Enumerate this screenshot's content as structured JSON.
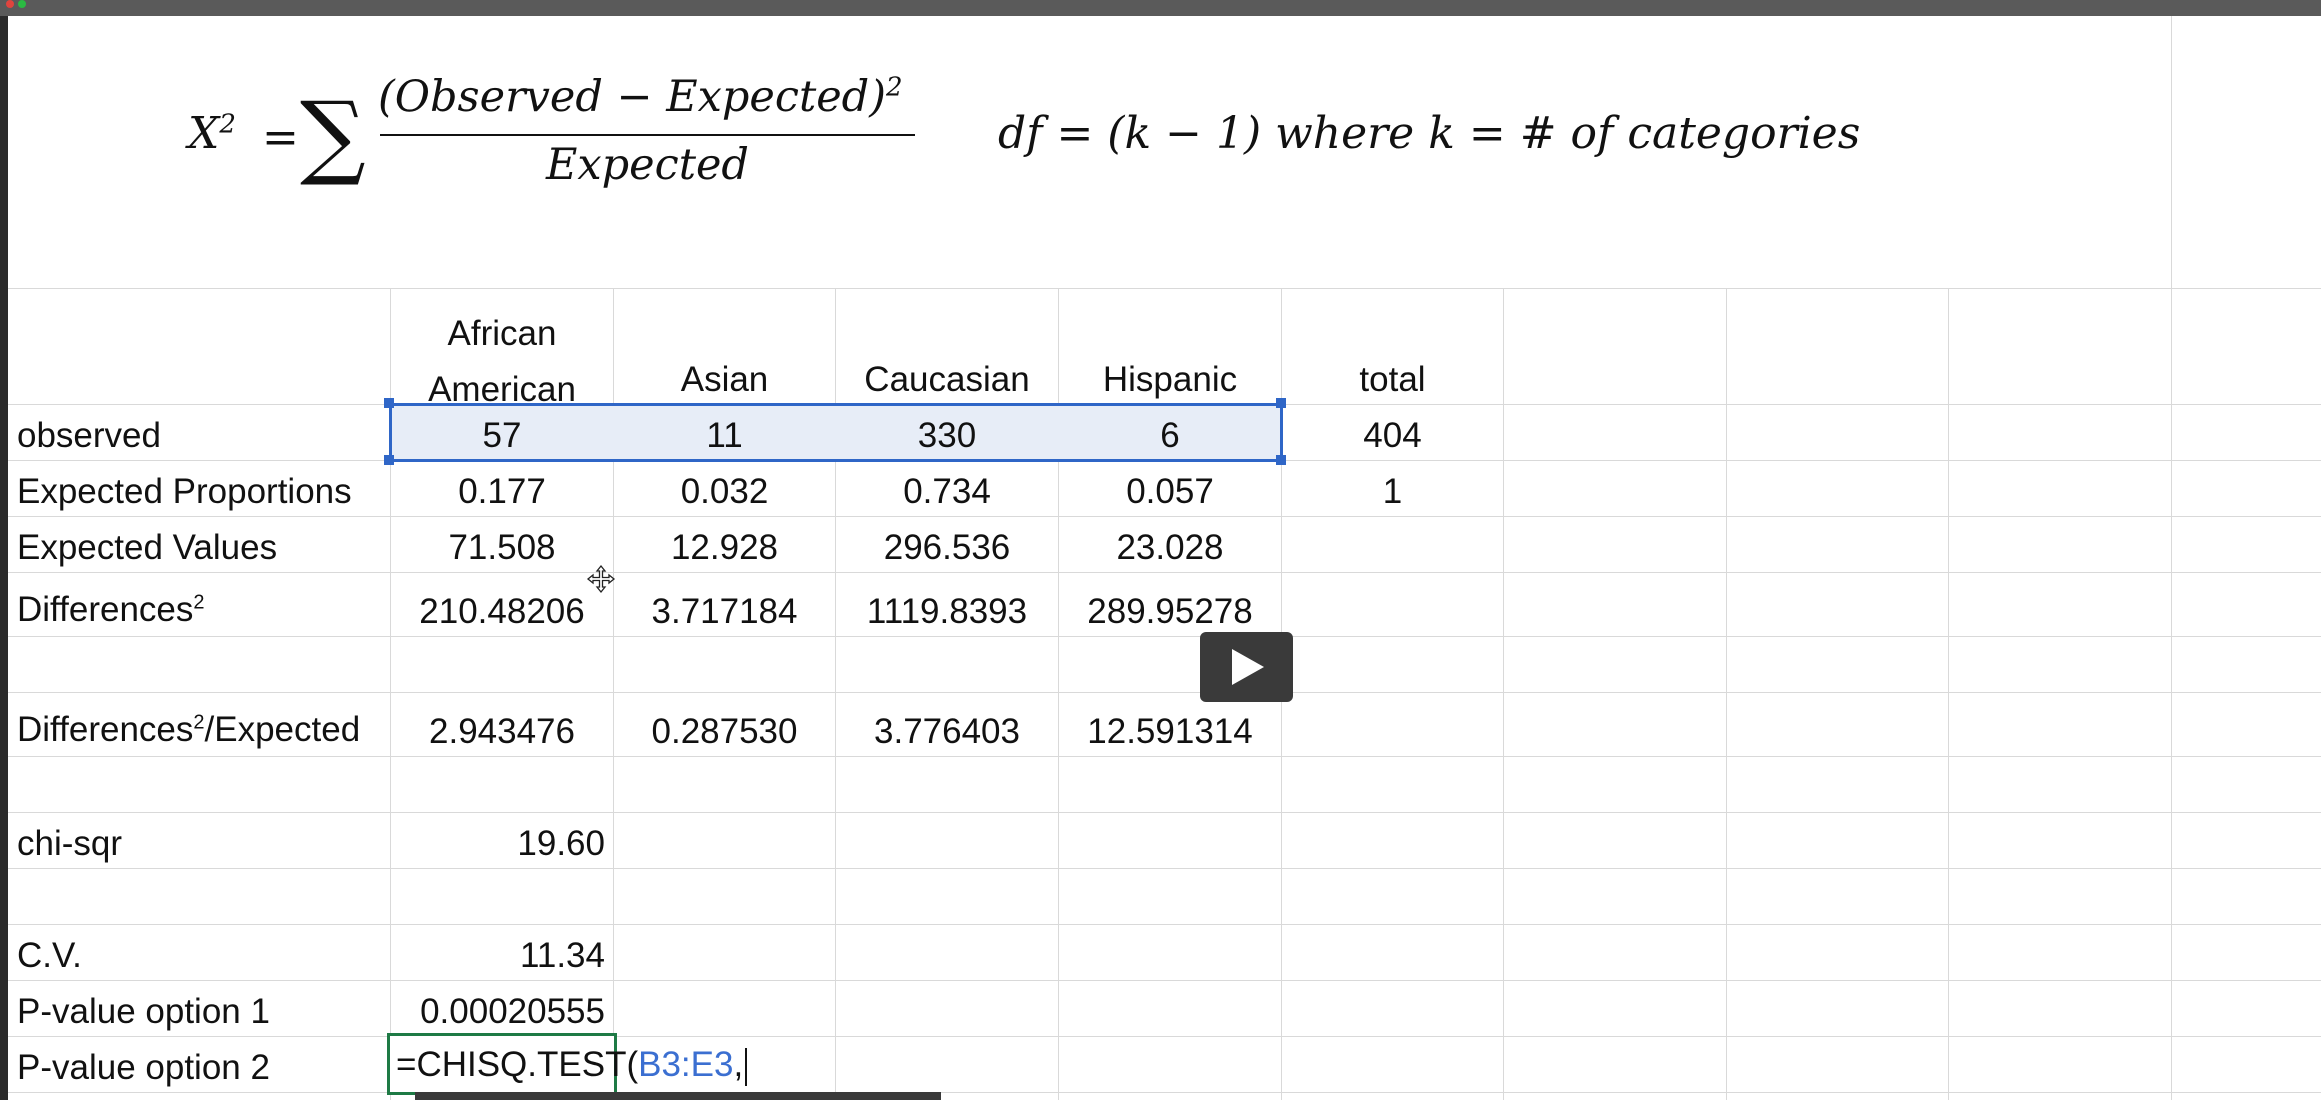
{
  "formula": {
    "chi_lhs": "X",
    "chi_exp": "2",
    "equals": "=",
    "sigma": "∑",
    "numerator": "(Observed  − Expected)",
    "numerator_exp": "2",
    "denominator": "Expected",
    "df_text": "df = (k − 1)  where k = # of categories"
  },
  "headers": {
    "col_b_line1": "African",
    "col_b_line2": "American",
    "col_c": "Asian",
    "col_d": "Caucasian",
    "col_e": "Hispanic",
    "col_g": "total"
  },
  "rows": {
    "observed": {
      "label": "observed",
      "values": [
        "57",
        "11",
        "330",
        "6"
      ],
      "total": "404"
    },
    "expected_proportions": {
      "label": "Expected Proportions",
      "values": [
        "0.177",
        "0.032",
        "0.734",
        "0.057"
      ],
      "total": "1"
    },
    "expected_values": {
      "label": "Expected Values",
      "values": [
        "71.508",
        "12.928",
        "296.536",
        "23.028"
      ]
    },
    "differences_sq": {
      "label": "Differences",
      "label_sup": "2",
      "values": [
        "210.48206",
        "3.717184",
        "1119.8393",
        "289.95278"
      ]
    },
    "diff_sq_over_expected": {
      "label_a": "Differences",
      "label_sup": "2",
      "label_b": "/Expected",
      "values": [
        "2.943476",
        "0.287530",
        "3.776403",
        "12.591314"
      ]
    },
    "chi_sqr": {
      "label": "chi-sqr",
      "value": "19.60"
    },
    "cv": {
      "label": "C.V.",
      "value": "11.34"
    },
    "p_value_1": {
      "label": "P-value option 1",
      "value": "0.00020555"
    },
    "p_value_2": {
      "label": "P-value option 2",
      "formula_prefix": "=CHISQ.TEST(",
      "formula_ref": "B3:E3",
      "formula_suffix": ","
    }
  },
  "icons": {
    "play": "play-icon",
    "move_cursor": "move-cursor-icon"
  },
  "colors": {
    "selection_border": "#2f66c7",
    "selection_fill": "#e7edf7",
    "edit_border": "#1e7a45",
    "formula_ref": "#3b6fd1"
  }
}
